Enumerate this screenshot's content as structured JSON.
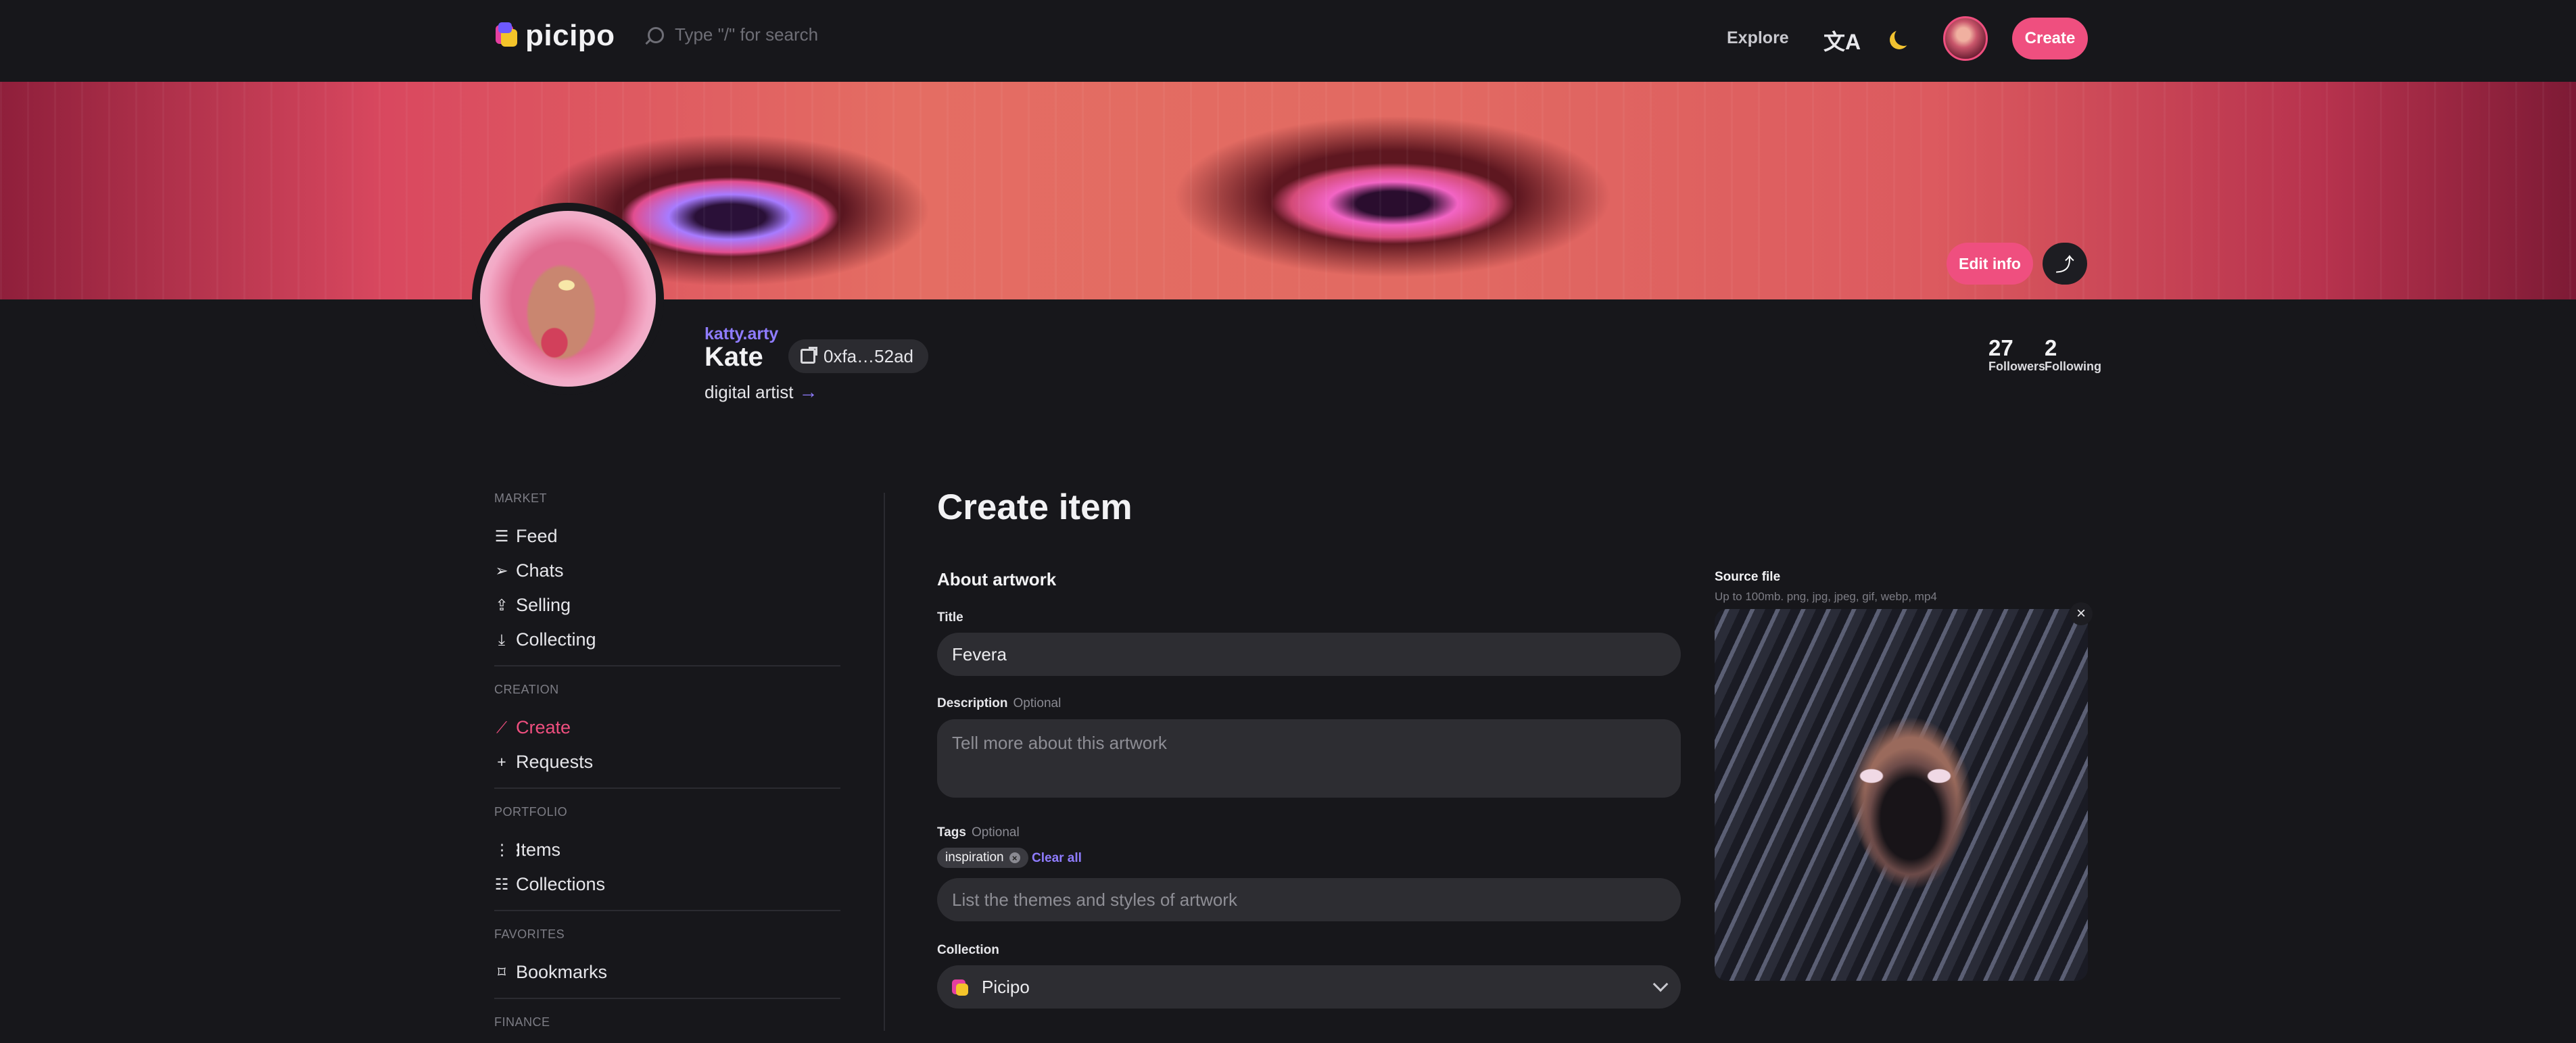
{
  "header": {
    "logo_text": "picipo",
    "search_placeholder": "Type \"/\" for search",
    "explore_label": "Explore",
    "create_label": "Create"
  },
  "profile": {
    "edit_label": "Edit info",
    "username": "katty.arty",
    "display_name": "Kate",
    "wallet": "0xfa…52ad",
    "bio": "digital artist",
    "followers_count": "27",
    "followers_label": "Followers",
    "following_count": "2",
    "following_label": "Following"
  },
  "sidebar": {
    "groups": [
      {
        "title": "MARKET",
        "items": [
          {
            "label": "Feed",
            "icon": "feed-icon"
          },
          {
            "label": "Chats",
            "icon": "send-icon"
          },
          {
            "label": "Selling",
            "icon": "upload-icon"
          },
          {
            "label": "Collecting",
            "icon": "download-icon"
          }
        ]
      },
      {
        "title": "CREATION",
        "items": [
          {
            "label": "Create",
            "icon": "magic-wand-icon",
            "active": true
          },
          {
            "label": "Requests",
            "icon": "plus-icon"
          }
        ]
      },
      {
        "title": "PORTFOLIO",
        "items": [
          {
            "label": "Items",
            "icon": "grid-icon"
          },
          {
            "label": "Collections",
            "icon": "sliders-icon"
          }
        ]
      },
      {
        "title": "FAVORITES",
        "items": [
          {
            "label": "Bookmarks",
            "icon": "bookmark-icon"
          }
        ]
      },
      {
        "title": "FINANCE",
        "items": []
      }
    ]
  },
  "form": {
    "page_title": "Create item",
    "section_title": "About artwork",
    "title_label": "Title",
    "title_value": "Fevera",
    "description_label": "Description",
    "optional": "Optional",
    "description_placeholder": "Tell more about this artwork",
    "tags_label": "Tags",
    "tag_value": "inspiration",
    "clear_all": "Clear all",
    "tags_placeholder": "List the themes and styles of artwork",
    "collection_label": "Collection",
    "collection_value": "Picipo"
  },
  "source": {
    "title": "Source file",
    "subtitle": "Up to 100mb. png, jpg, jpeg, gif, webp, mp4"
  },
  "colors": {
    "accent_pink": "#ef4f7f",
    "accent_purple": "#8f7cff",
    "background": "#17171b"
  }
}
